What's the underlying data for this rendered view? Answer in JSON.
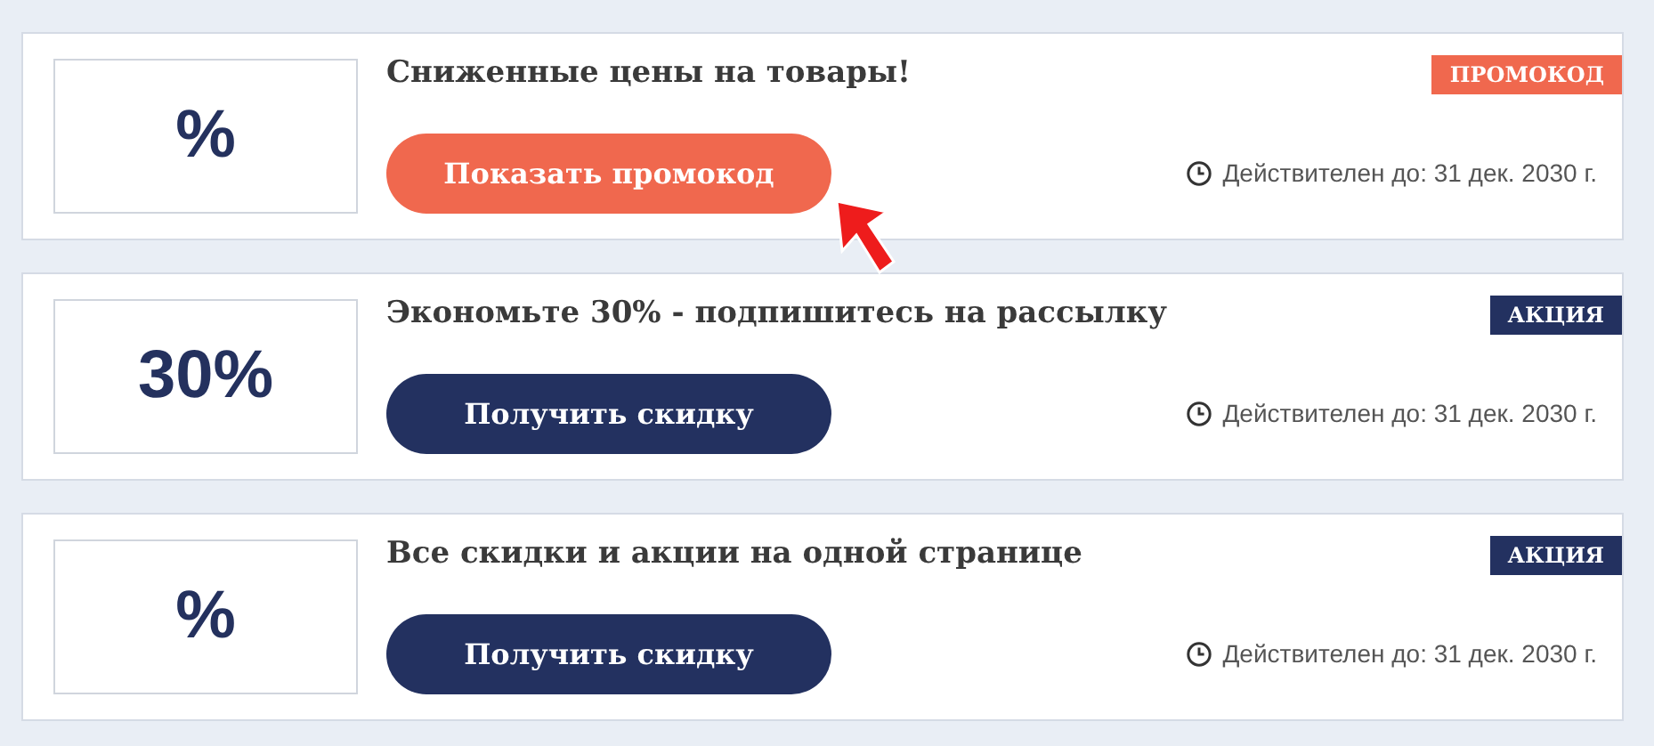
{
  "offers": [
    {
      "kind": "promocode",
      "logo": "%",
      "title": "Сниженные цены на товары!",
      "button": "Показать промокод",
      "badge": "ПРОМОКОД",
      "validity": "Действителен до: 31 дек. 2030 г.",
      "pointer": true
    },
    {
      "kind": "deal",
      "logo": "30%",
      "title": "Экономьте 30% - подпишитесь на рассылку",
      "button": "Получить скидку",
      "badge": "АКЦИЯ",
      "validity": "Действителен до: 31 дек. 2030 г.",
      "pointer": false
    },
    {
      "kind": "deal",
      "logo": "%",
      "title": "Все скидки и акции на одной странице",
      "button": "Получить скидку",
      "badge": "АКЦИЯ",
      "validity": "Действителен до: 31 дек. 2030 г.",
      "pointer": false
    }
  ]
}
